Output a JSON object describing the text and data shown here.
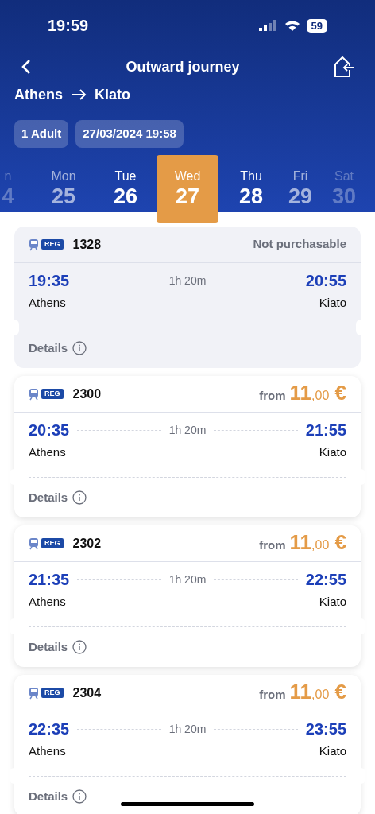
{
  "status_bar": {
    "time": "19:59",
    "battery": "59"
  },
  "header": {
    "title": "Outward journey",
    "origin": "Athens",
    "destination": "Kiato",
    "chips": [
      "1 Adult",
      "27/03/2024 19:58"
    ]
  },
  "days": [
    {
      "weekday": "n",
      "day": "4",
      "selected": false
    },
    {
      "weekday": "Mon",
      "day": "25",
      "selected": false
    },
    {
      "weekday": "Tue",
      "day": "26",
      "selected": false
    },
    {
      "weekday": "Wed",
      "day": "27",
      "selected": true
    },
    {
      "weekday": "Thu",
      "day": "28",
      "selected": false
    },
    {
      "weekday": "Fri",
      "day": "29",
      "selected": false
    },
    {
      "weekday": "Sat",
      "day": "30",
      "selected": false
    }
  ],
  "trains": [
    {
      "badge": "REG",
      "number": "1328",
      "purchasable": false,
      "status": "Not purchasable",
      "depart": "19:35",
      "arrive": "20:55",
      "duration": "1h 20m",
      "from": "Athens",
      "to": "Kiato",
      "details": "Details"
    },
    {
      "badge": "REG",
      "number": "2300",
      "purchasable": true,
      "price_prefix": "from",
      "price_whole": "11",
      "price_cents": ",00",
      "currency": "€",
      "depart": "20:35",
      "arrive": "21:55",
      "duration": "1h 20m",
      "from": "Athens",
      "to": "Kiato",
      "details": "Details"
    },
    {
      "badge": "REG",
      "number": "2302",
      "purchasable": true,
      "price_prefix": "from",
      "price_whole": "11",
      "price_cents": ",00",
      "currency": "€",
      "depart": "21:35",
      "arrive": "22:55",
      "duration": "1h 20m",
      "from": "Athens",
      "to": "Kiato",
      "details": "Details"
    },
    {
      "badge": "REG",
      "number": "2304",
      "purchasable": true,
      "price_prefix": "from",
      "price_whole": "11",
      "price_cents": ",00",
      "currency": "€",
      "depart": "22:35",
      "arrive": "23:55",
      "duration": "1h 20m",
      "from": "Athens",
      "to": "Kiato",
      "details": "Details"
    }
  ]
}
